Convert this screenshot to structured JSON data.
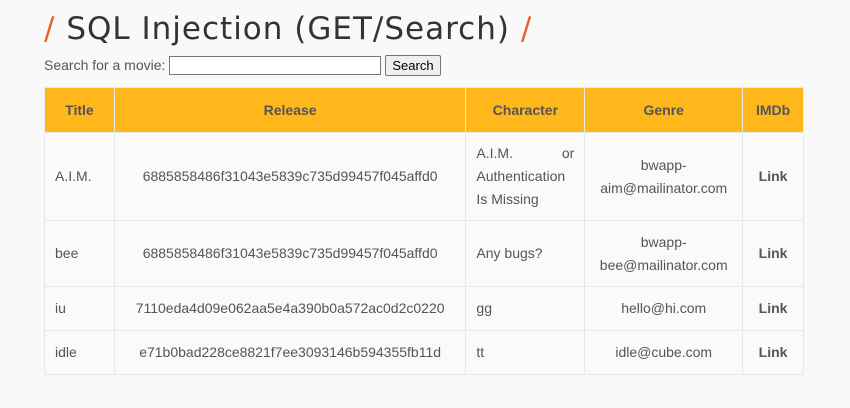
{
  "header": {
    "slash_left": "/",
    "title": "SQL Injection (GET/Search)",
    "slash_right": "/"
  },
  "search": {
    "label": "Search for a movie:",
    "value": "",
    "placeholder": "",
    "button_label": "Search"
  },
  "table": {
    "columns": [
      "Title",
      "Release",
      "Character",
      "Genre",
      "IMDb"
    ],
    "rows": [
      {
        "title": "A.I.M.",
        "release": "6885858486f31043e5839c735d99457f045affd0",
        "character": "A.I.M. or Authentication Is Missing",
        "genre": "bwapp-aim@mailinator.com",
        "imdb": "Link"
      },
      {
        "title": "bee",
        "release": "6885858486f31043e5839c735d99457f045affd0",
        "character": "Any bugs?",
        "genre": "bwapp-bee@mailinator.com",
        "imdb": "Link"
      },
      {
        "title": "iu",
        "release": "7110eda4d09e062aa5e4a390b0a572ac0d2c0220",
        "character": "gg",
        "genre": "hello@hi.com",
        "imdb": "Link"
      },
      {
        "title": "idle",
        "release": "e71b0bad228ce8821f7ee3093146b594355fb11d",
        "character": "tt",
        "genre": "idle@cube.com",
        "imdb": "Link"
      }
    ]
  },
  "colors": {
    "header_bg": "#ffb71b",
    "slash": "#e56531",
    "text": "#555555"
  }
}
